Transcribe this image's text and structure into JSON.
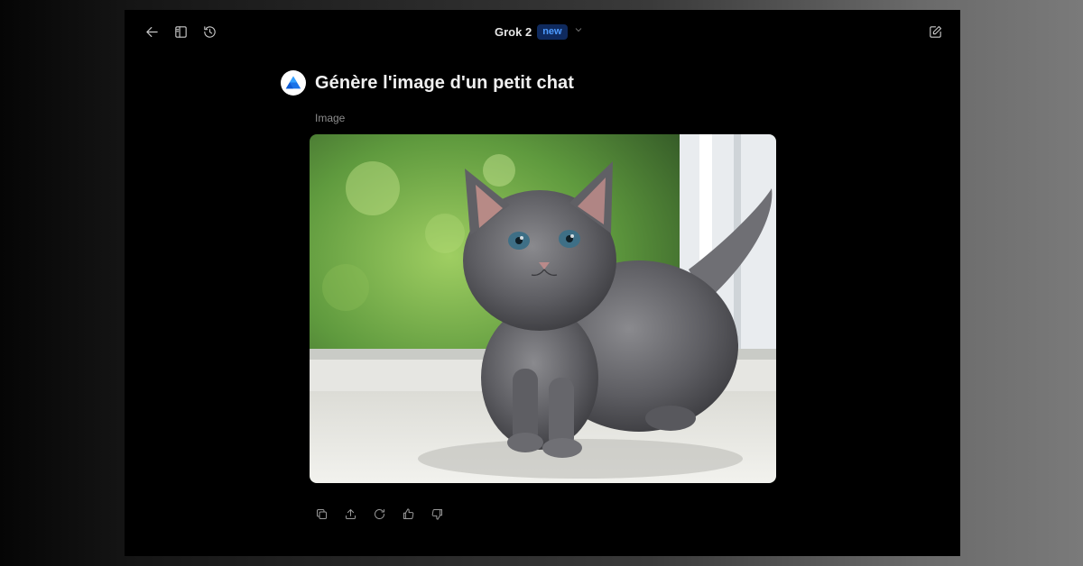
{
  "header": {
    "model_name": "Grok 2",
    "model_badge": "new",
    "icons": [
      "back-arrow-icon",
      "sidebar-toggle-icon",
      "history-icon",
      "chevron-down-icon",
      "new-chat-edit-icon"
    ]
  },
  "conversation": {
    "prompt": "Génère l'image d'un petit chat",
    "response_label": "Image",
    "image_subject": "grey kitten on windowsill"
  },
  "actions": [
    "copy-icon",
    "share-icon",
    "regenerate-icon",
    "thumbs-up-icon",
    "thumbs-down-icon"
  ],
  "colors": {
    "background": "#000000",
    "badge_bg": "#0f2a5e",
    "badge_text": "#4d9bff",
    "logo_blue": "#1a73e8"
  }
}
